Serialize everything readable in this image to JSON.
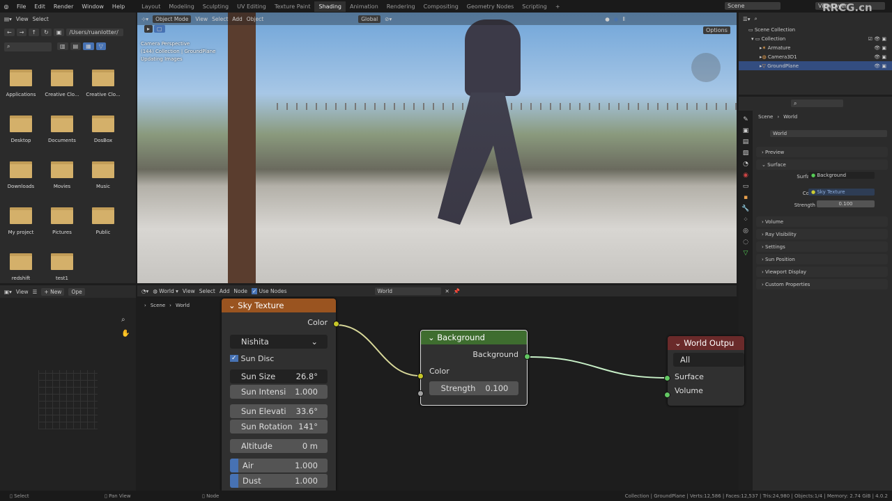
{
  "topbar": {
    "menus": [
      "File",
      "Edit",
      "Render",
      "Window",
      "Help"
    ],
    "workspaces": [
      "Layout",
      "Modeling",
      "Sculpting",
      "UV Editing",
      "Texture Paint",
      "Shading",
      "Animation",
      "Rendering",
      "Compositing",
      "Geometry Nodes",
      "Scripting"
    ],
    "active_workspace": "Shading",
    "scene": "Scene",
    "view_layer": "ViewLayer"
  },
  "file_browser": {
    "menus": [
      "View",
      "Select"
    ],
    "path": "/Users/ruanlotter/",
    "folders": [
      "Applications",
      "Creative Clo...",
      "Creative Clo...",
      "Desktop",
      "Documents",
      "DosBox",
      "Downloads",
      "Movies",
      "Music",
      "My project",
      "Pictures",
      "Public",
      "redshift",
      "test1"
    ]
  },
  "viewport": {
    "mode": "Object Mode",
    "menus": [
      "View",
      "Select",
      "Add",
      "Object"
    ],
    "orientation": "Global",
    "options": "Options",
    "overlay_lines": [
      "Camera Perspective",
      "(144) Collection | GroundPlane",
      "Updating Images"
    ]
  },
  "outliner": {
    "root": "Scene Collection",
    "collection": "Collection",
    "objects": [
      "Armature",
      "Camera3D1",
      "GroundPlane"
    ],
    "selected": "GroundPlane"
  },
  "properties": {
    "breadcrumb": [
      "Scene",
      "World"
    ],
    "world_name": "World",
    "sections": {
      "preview": "Preview",
      "surface": "Surface",
      "volume": "Volume",
      "ray_visibility": "Ray Visibility",
      "settings": "Settings",
      "sun_position": "Sun Position",
      "viewport_display": "Viewport Display",
      "custom_properties": "Custom Properties"
    },
    "surface_label": "Surface",
    "surface_value": "Background",
    "color_label": "Color",
    "color_value": "Sky Texture",
    "strength_label": "Strength",
    "strength_value": "0.100"
  },
  "image_editor": {
    "view": "View",
    "new": "New",
    "open": "Ope"
  },
  "node_editor": {
    "type": "World",
    "menus": [
      "View",
      "Select",
      "Add",
      "Node"
    ],
    "use_nodes": "Use Nodes",
    "world": "World",
    "breadcrumb": [
      "Scene",
      "World"
    ],
    "sky_texture": {
      "title": "Sky Texture",
      "output": "Color",
      "sky_type": "Nishita",
      "sun_disc": "Sun Disc",
      "fields": [
        [
          "Sun Size",
          "26.8°"
        ],
        [
          "Sun Intensi",
          "1.000"
        ],
        [
          "Sun Elevati",
          "33.6°"
        ],
        [
          "Sun Rotation",
          "141°"
        ],
        [
          "Altitude",
          "0 m"
        ],
        [
          "Air",
          "1.000"
        ],
        [
          "Dust",
          "1.000"
        ]
      ]
    },
    "background": {
      "title": "Background",
      "output": "Background",
      "input_color": "Color",
      "strength_label": "Strength",
      "strength_value": "0.100"
    },
    "world_output": {
      "title": "World Outpu",
      "target": "All",
      "surface": "Surface",
      "volume": "Volume"
    }
  },
  "status": {
    "left": [
      "Select",
      "Pan View",
      "Node"
    ],
    "right": "Collection | GroundPlane | Verts:12,586 | Faces:12,537 | Tris:24,980 | Objects:1/4 | Memory: 2.74 GiB | 4.0.2"
  },
  "watermark": "RRCG.cn",
  "colors": {
    "sky_header": "#9a5420",
    "bg_header": "#3e6d2f",
    "out_header": "#6a2a2a",
    "yellow_socket": "#c7c729",
    "green_socket": "#63c763",
    "selected": "#334d80"
  }
}
